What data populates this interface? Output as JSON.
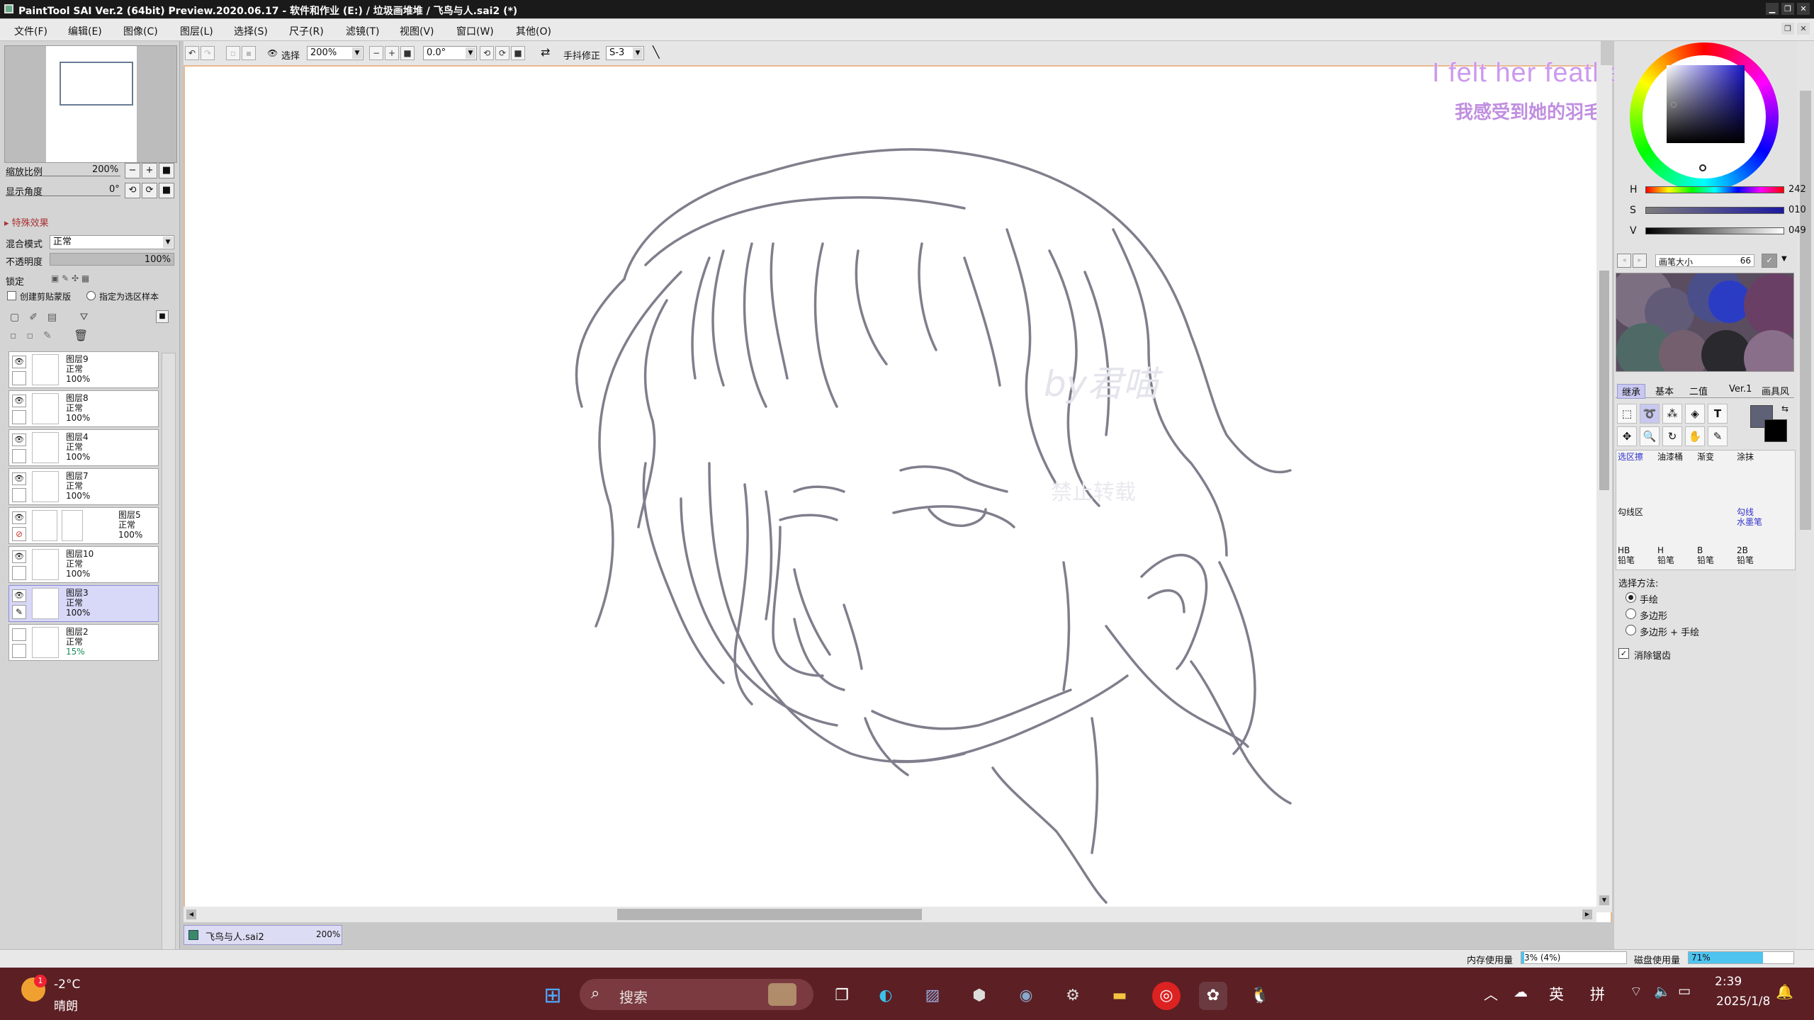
{
  "window": {
    "title": "PaintTool SAI Ver.2 (64bit) Preview.2020.06.17 - 软件和作业 (E:) / 垃圾画堆堆 / 飞鸟与人.sai2 (*)"
  },
  "menu": [
    "文件(F)",
    "编辑(E)",
    "图像(C)",
    "图层(L)",
    "选择(S)",
    "尺子(R)",
    "滤镜(T)",
    "视图(V)",
    "窗口(W)",
    "其他(O)"
  ],
  "toolbar": {
    "select_label": "选择",
    "zoom": "200%",
    "angle": "0.0°",
    "stabilizer_label": "手抖修正",
    "stabilizer_value": "S-3"
  },
  "navigator": {
    "zoom_label": "缩放比例",
    "zoom_value": "200%",
    "angle_label": "显示角度",
    "angle_value": "0°"
  },
  "layer_props": {
    "section": "特殊效果",
    "blend_label": "混合模式",
    "blend_value": "正常",
    "opacity_label": "不透明度",
    "opacity_value": "100%",
    "lock_label": "锁定",
    "clip_label": "创建剪贴蒙版",
    "sample_label": "指定为选区样本"
  },
  "layers": [
    {
      "name": "图层9",
      "mode": "正常",
      "opacity": "100%"
    },
    {
      "name": "图层8",
      "mode": "正常",
      "opacity": "100%"
    },
    {
      "name": "图层4",
      "mode": "正常",
      "opacity": "100%"
    },
    {
      "name": "图层7",
      "mode": "正常",
      "opacity": "100%"
    },
    {
      "name": "图层5",
      "mode": "正常",
      "opacity": "100%"
    },
    {
      "name": "图层10",
      "mode": "正常",
      "opacity": "100%"
    },
    {
      "name": "图层3",
      "mode": "正常",
      "opacity": "100%"
    },
    {
      "name": "图层2",
      "mode": "正常",
      "opacity": "15%"
    }
  ],
  "canvas": {
    "caption_en": "I felt her feathers",
    "caption_cn": "我感受到她的羽毛",
    "watermark1": "by君喵",
    "watermark2": "禁止转载",
    "doc_tab": "飞鸟与人.sai2",
    "doc_zoom": "200%"
  },
  "color": {
    "h_label": "H",
    "h": "242",
    "s_label": "S",
    "s": "010",
    "v_label": "V",
    "v": "049",
    "brush_size_label": "画笔大小",
    "brush_size": "66",
    "current": "#5f6177"
  },
  "tool_tabs": [
    "继承",
    "基本",
    "二值",
    "Ver.1",
    "画具风"
  ],
  "brushes": {
    "row1": [
      "选区擦",
      "油漆桶",
      "渐变",
      "涂抹"
    ],
    "row2": [
      "勾线区",
      "",
      "",
      "勾线\n水墨笔"
    ],
    "row3_top": [
      "HB",
      "H",
      "B",
      "2B"
    ],
    "row3_bottom": [
      "铅笔",
      "铅笔",
      "铅笔",
      "铅笔"
    ]
  },
  "selection": {
    "method_label": "选择方法:",
    "options": [
      "手绘",
      "多边形",
      "多边形 + 手绘"
    ],
    "antialias": "消除锯齿"
  },
  "status": {
    "mem_label": "内存使用量",
    "mem": "3% (4%)",
    "disk_label": "磁盘使用量",
    "disk": "71%",
    "disk_fraction": 0.71,
    "mem_fraction": 0.03
  },
  "taskbar": {
    "weather_temp": "-2°C",
    "weather_desc": "晴朗",
    "weather_badge": "1",
    "search": "搜索",
    "ime1": "英",
    "ime2": "拼",
    "time": "2:39",
    "date": "2025/1/8"
  }
}
